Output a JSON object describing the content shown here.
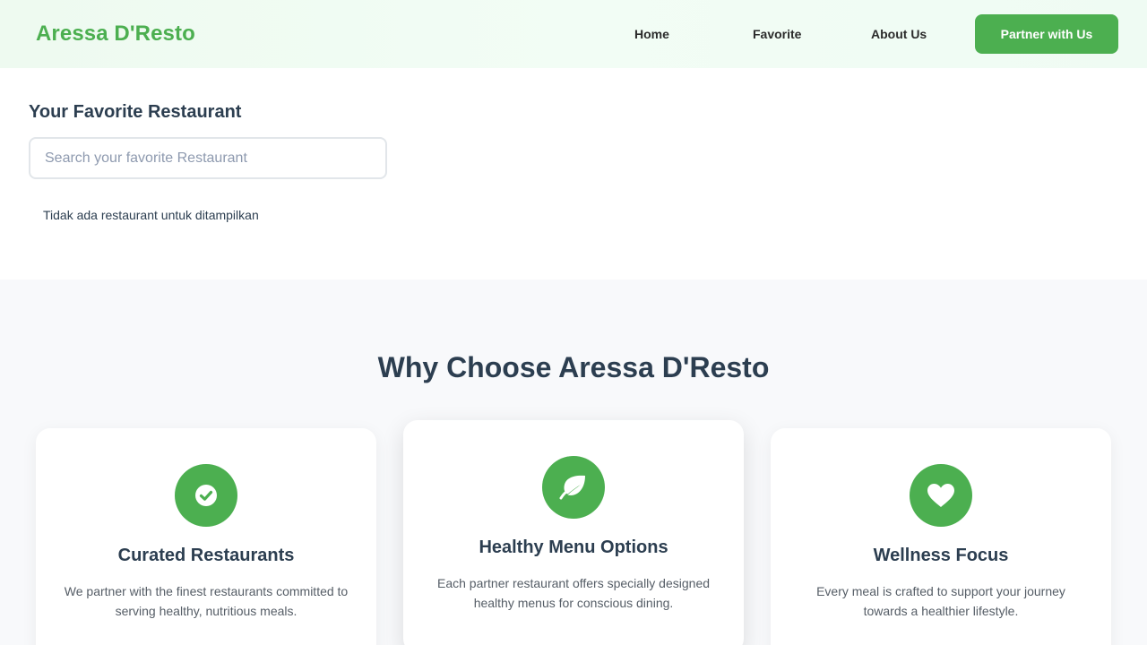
{
  "navbar": {
    "brand": "Aressa D'Resto",
    "links": [
      {
        "label": "Home"
      },
      {
        "label": "Favorite"
      },
      {
        "label": "About Us"
      }
    ],
    "partner_button": "Partner with Us"
  },
  "favorites": {
    "title": "Your Favorite Restaurant",
    "search_placeholder": "Search your favorite Restaurant",
    "search_value": "",
    "empty_message": "Tidak ada restaurant untuk ditampilkan"
  },
  "why": {
    "title": "Why Choose Aressa D'Resto",
    "cards": [
      {
        "icon": "check-circle-icon",
        "title": "Curated Restaurants",
        "description": "We partner with the finest restaurants committed to serving healthy, nutritious meals."
      },
      {
        "icon": "leaf-icon",
        "title": "Healthy Menu Options",
        "description": "Each partner restaurant offers specially designed healthy menus for conscious dining."
      },
      {
        "icon": "heart-icon",
        "title": "Wellness Focus",
        "description": "Every meal is crafted to support your journey towards a healthier lifestyle."
      }
    ]
  },
  "colors": {
    "accent": "#4caf50",
    "heading": "#2c3e50",
    "section_bg": "#f8f9fb"
  }
}
